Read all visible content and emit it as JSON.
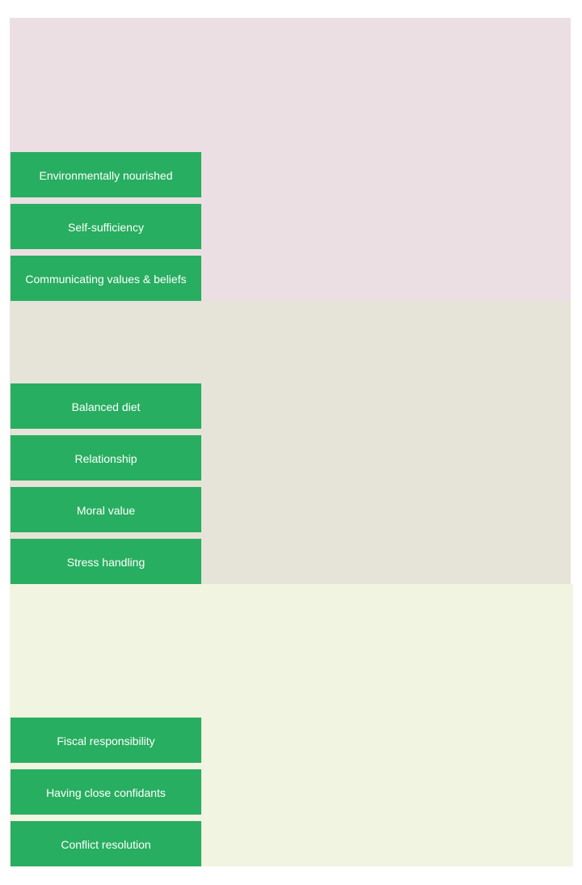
{
  "colors": {
    "background": "#ffffff",
    "card": "#28ae60",
    "card_text": "#ffffff",
    "zone_1": "#ecdfe3",
    "zone_2": "#e6e4d8",
    "zone_3": "#f1f4e0"
  },
  "zones": [
    {
      "cards": [
        {
          "label": "Environmentally nourished"
        },
        {
          "label": "Self-sufficiency"
        },
        {
          "label": "Communicating values & beliefs"
        }
      ]
    },
    {
      "cards": [
        {
          "label": "Balanced diet"
        },
        {
          "label": "Relationship"
        },
        {
          "label": "Moral value"
        },
        {
          "label": "Stress handling"
        }
      ]
    },
    {
      "cards": [
        {
          "label": "Fiscal responsibility"
        },
        {
          "label": "Having close confidants"
        },
        {
          "label": "Conflict resolution"
        }
      ]
    }
  ]
}
